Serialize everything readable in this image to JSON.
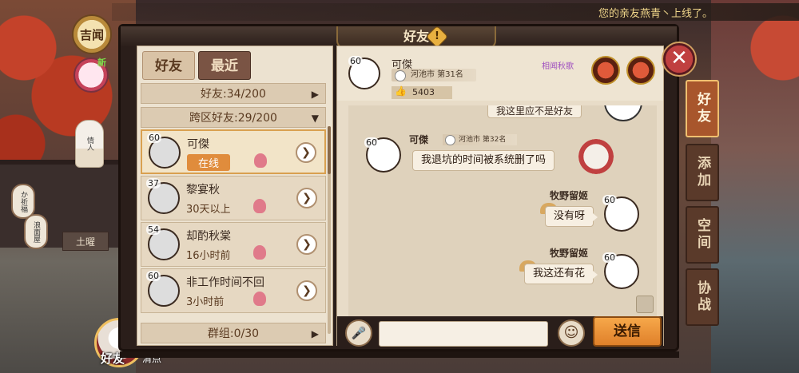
{
  "notification": "您的亲友燕青丶上线了。",
  "left_hud": {
    "jiwen_label": "吉闻",
    "new_label": "新",
    "doll_text": "情人",
    "sign_text": "土曜",
    "lantern_1": "か祈福",
    "lantern_2": "浪面屋",
    "friend_button_label": "好友",
    "qingdian_label": "清点"
  },
  "window": {
    "title": "好友",
    "alert_icon": "!"
  },
  "list": {
    "tab_friends": "好友",
    "tab_recent": "最近",
    "friend_count": "好友:34/200",
    "cross_count": "跨区好友:29/200",
    "group_count": "群组:0/30",
    "friends": [
      {
        "level": "60",
        "name": "可傑",
        "status": "在线",
        "online": true
      },
      {
        "level": "37",
        "name": "黎宴秋",
        "status": "30天以上",
        "online": false
      },
      {
        "level": "54",
        "name": "却酌秋棠",
        "status": "16小时前",
        "online": false
      },
      {
        "level": "60",
        "name": "非工作时间不回",
        "status": "3小时前",
        "online": false
      }
    ]
  },
  "chat": {
    "header": {
      "level": "60",
      "name": "可傑",
      "region": "河池市 第31名",
      "likes": "5403",
      "poem": "相闻秋歌"
    },
    "top_cut_message": "我这里应不是好友",
    "messages": [
      {
        "side": "left",
        "level": "60",
        "sender": "可傑",
        "region": "河池市 第32名",
        "text": "我退坑的时间被系统删了吗"
      },
      {
        "side": "right",
        "level": "60",
        "sender": "牧野留姬",
        "text": "没有呀"
      },
      {
        "side": "right",
        "level": "60",
        "sender": "牧野留姬",
        "text": "我这还有花"
      }
    ],
    "input_placeholder": "",
    "voice_icon": "🎤",
    "emoji_icon": "☺",
    "send_label": "送信"
  },
  "close_icon": "✕",
  "right_tabs": [
    "好友",
    "添加",
    "空间",
    "协战"
  ],
  "colors": {
    "accent": "#e0802a",
    "online": "#e08c3c",
    "panel": "#ece2d0",
    "frame": "#2a1e1a"
  }
}
